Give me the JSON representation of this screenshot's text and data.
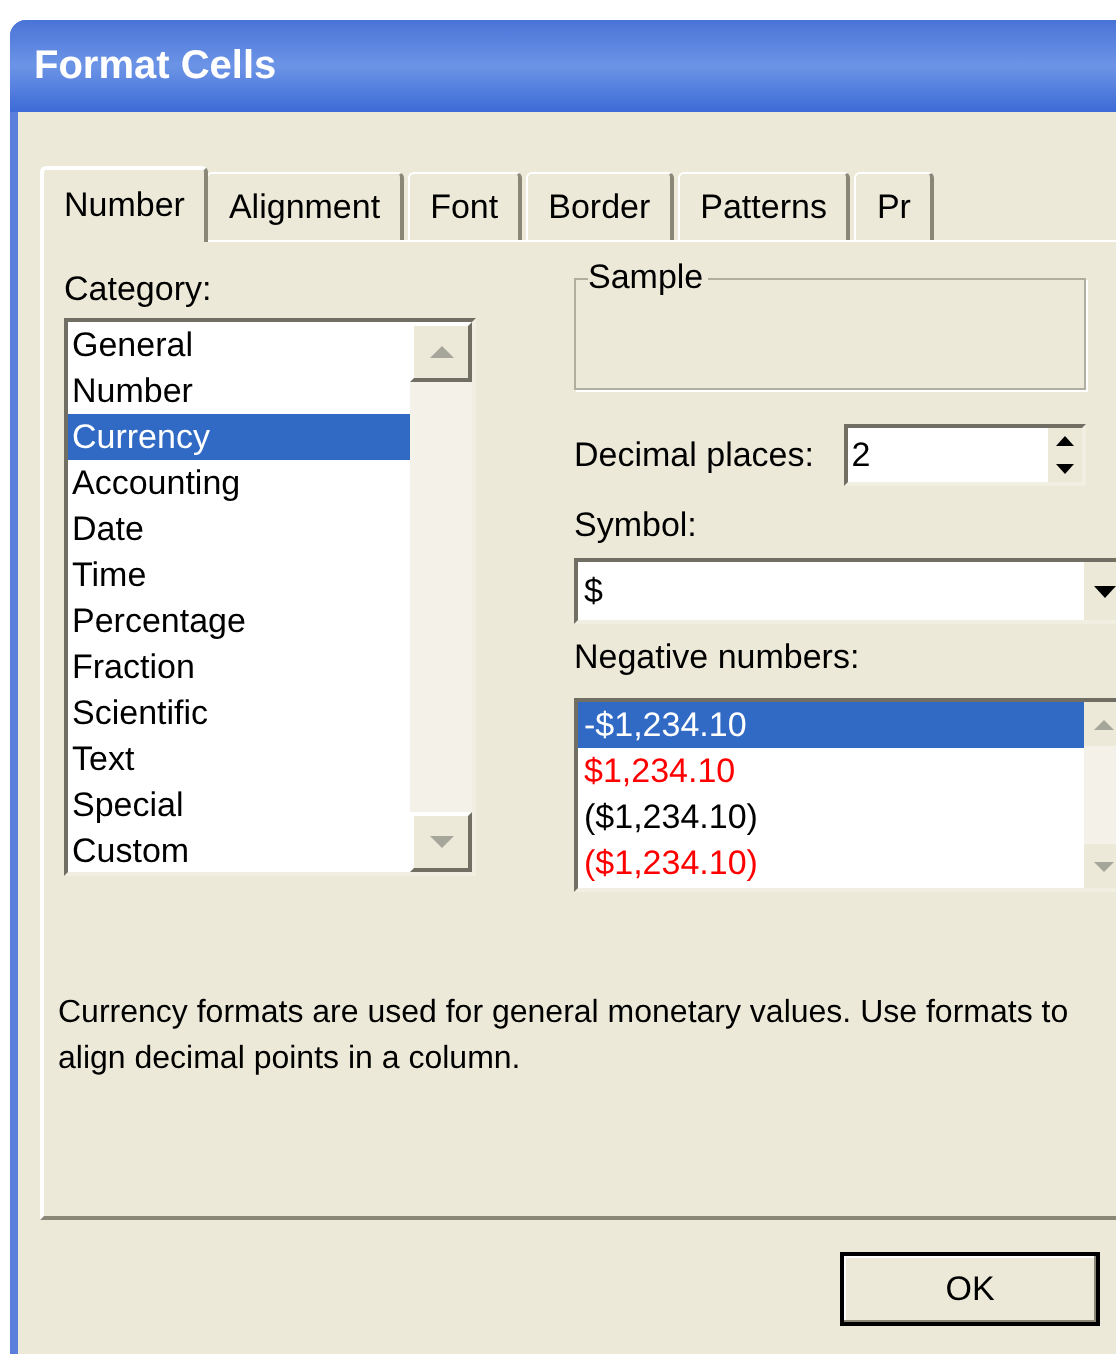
{
  "window": {
    "title": "Format Cells"
  },
  "tabs": [
    {
      "label": "Number",
      "selected": true
    },
    {
      "label": "Alignment",
      "selected": false
    },
    {
      "label": "Font",
      "selected": false
    },
    {
      "label": "Border",
      "selected": false
    },
    {
      "label": "Patterns",
      "selected": false
    },
    {
      "label": "Pr",
      "selected": false
    }
  ],
  "category": {
    "label": "Category:",
    "items": [
      {
        "label": "General",
        "selected": false
      },
      {
        "label": "Number",
        "selected": false
      },
      {
        "label": "Currency",
        "selected": true
      },
      {
        "label": "Accounting",
        "selected": false
      },
      {
        "label": "Date",
        "selected": false
      },
      {
        "label": "Time",
        "selected": false
      },
      {
        "label": "Percentage",
        "selected": false
      },
      {
        "label": "Fraction",
        "selected": false
      },
      {
        "label": "Scientific",
        "selected": false
      },
      {
        "label": "Text",
        "selected": false
      },
      {
        "label": "Special",
        "selected": false
      },
      {
        "label": "Custom",
        "selected": false
      }
    ]
  },
  "sample": {
    "label": "Sample"
  },
  "decimal_places": {
    "label": "Decimal places:",
    "value": "2"
  },
  "symbol": {
    "label": "Symbol:",
    "value": "$"
  },
  "negative_numbers": {
    "label": "Negative numbers:",
    "items": [
      {
        "label": "-$1,234.10",
        "selected": true
      },
      {
        "label": "$1,234.10",
        "selected": false,
        "color": "#ff0000"
      },
      {
        "label": "($1,234.10)",
        "selected": false,
        "color": "#000000"
      },
      {
        "label": "($1,234.10)",
        "selected": false,
        "color": "#ff0000"
      }
    ]
  },
  "description": "Currency formats are used for general monetary values.  Use formats to align decimal points in a column.",
  "buttons": [
    "OK"
  ]
}
